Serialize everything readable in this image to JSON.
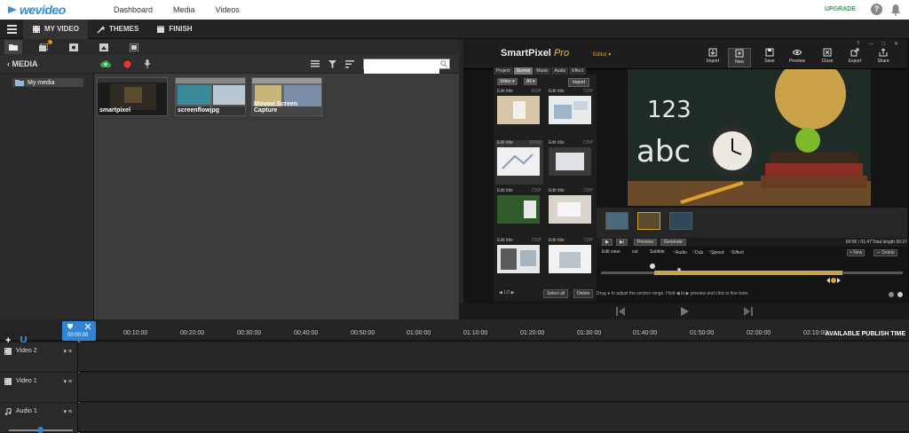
{
  "topnav": {
    "logo": "wevideo",
    "links": [
      "Dashboard",
      "Media",
      "Videos"
    ],
    "upgrade": "UPGRADE",
    "help": "?"
  },
  "tabs": [
    {
      "label": "MY VIDEO"
    },
    {
      "label": "THEMES"
    },
    {
      "label": "FINISH"
    }
  ],
  "media": {
    "title": "MEDIA",
    "search_placeholder": "",
    "folder": "My media",
    "thumbs": [
      "smartpixel",
      "screenflowjpg",
      "Movavi Screen Capture"
    ]
  },
  "smartpixel": {
    "brand": "SmartPixel",
    "brand_suffix": "Pro",
    "editor": "Editor ▾",
    "window_controls": "? — □ ✕",
    "buttons": [
      "Import",
      "New",
      "Save",
      "Preview",
      "Close",
      "Export",
      "Share"
    ],
    "tabs": [
      "Project",
      "Screen",
      "Music",
      "Audio",
      "Effect"
    ],
    "dropdown_type": "Video ▾",
    "dropdown_filter": "All ▾",
    "import": "Import",
    "cards": [
      {
        "title": "Edit title",
        "res": "960P"
      },
      {
        "title": "Edit title",
        "res": "720P"
      },
      {
        "title": "Edit title",
        "res": "1080P"
      },
      {
        "title": "Edit title",
        "res": "720P"
      },
      {
        "title": "Edit title",
        "res": "720P"
      },
      {
        "title": "Edit title",
        "res": "720P"
      },
      {
        "title": "Edit title",
        "res": "720P"
      },
      {
        "title": "Edit title",
        "res": "720P"
      }
    ],
    "pager": "◀ 1/2 ▶",
    "select_all": "Select all",
    "delete_left": "Delete",
    "play": "▶",
    "step": "▶|",
    "preview": "Preview",
    "generate": "Generate",
    "time": "00:00 / 01:47",
    "total": "Total length 00:27",
    "new": "+ New",
    "delete": "— Delete",
    "edit_view_label": "Edit view:",
    "edit_view_value": "cut",
    "options": [
      "Subtitle",
      "Audio",
      "Dub",
      "Speed",
      "Effect"
    ],
    "drag_hint": "Drag ● to adjust the section range. Hold ◀ to ▶ preview and click to fine-tune.",
    "canvas_text_num": "123",
    "canvas_text_abc": "abc"
  },
  "timeline": {
    "playhead": "00:00:00",
    "ticks": [
      "00:10:00",
      "00:20:00",
      "00:30:00",
      "00:40:00",
      "00:50:00",
      "01:00:00",
      "01:10:00",
      "01:20:00",
      "01:30:00",
      "01:40:00",
      "01:50:00",
      "02:00:00",
      "02:10:00"
    ],
    "publish": "AVAILABLE PUBLISH TIME",
    "tracks": [
      "Video 2",
      "Video 1",
      "Audio 1"
    ]
  },
  "colors": {
    "accent": "#2c86d5",
    "upgrade": "#2ba84a",
    "brand_gold": "#f0c040"
  }
}
